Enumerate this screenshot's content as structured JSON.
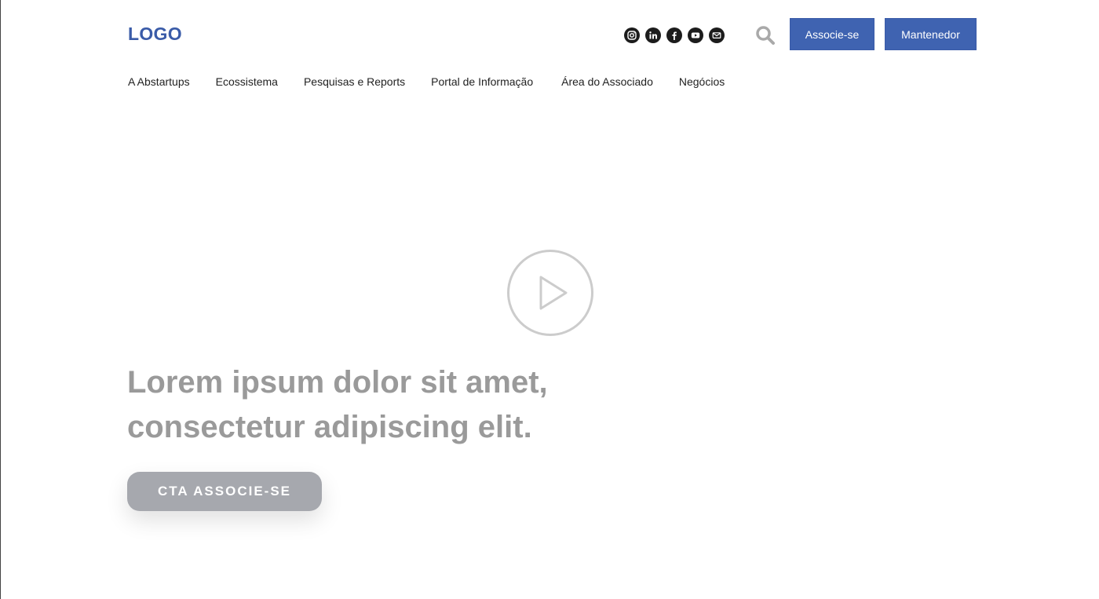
{
  "header": {
    "logo": "LOGO",
    "social_icons": [
      "instagram-icon",
      "linkedin-icon",
      "facebook-icon",
      "youtube-icon",
      "email-icon"
    ],
    "buttons": {
      "associe": "Associe-se",
      "mantenedor": "Mantenedor"
    }
  },
  "nav": {
    "items": [
      {
        "label": "A Abstartups"
      },
      {
        "label": "Ecossistema"
      },
      {
        "label": "Pesquisas e Reports"
      },
      {
        "label": "Portal de Informação"
      },
      {
        "label": "Área do Associado"
      },
      {
        "label": "Negócios"
      }
    ]
  },
  "hero": {
    "headline_line1": "Lorem ipsum dolor sit amet,",
    "headline_line2": "consectetur adipiscing elit.",
    "cta_label": "CTA ASSOCIE-SE"
  },
  "colors": {
    "brand_blue": "#3f63b1",
    "cta_gray": "#a6a8ae",
    "headline_gray": "#9a9a9a"
  }
}
